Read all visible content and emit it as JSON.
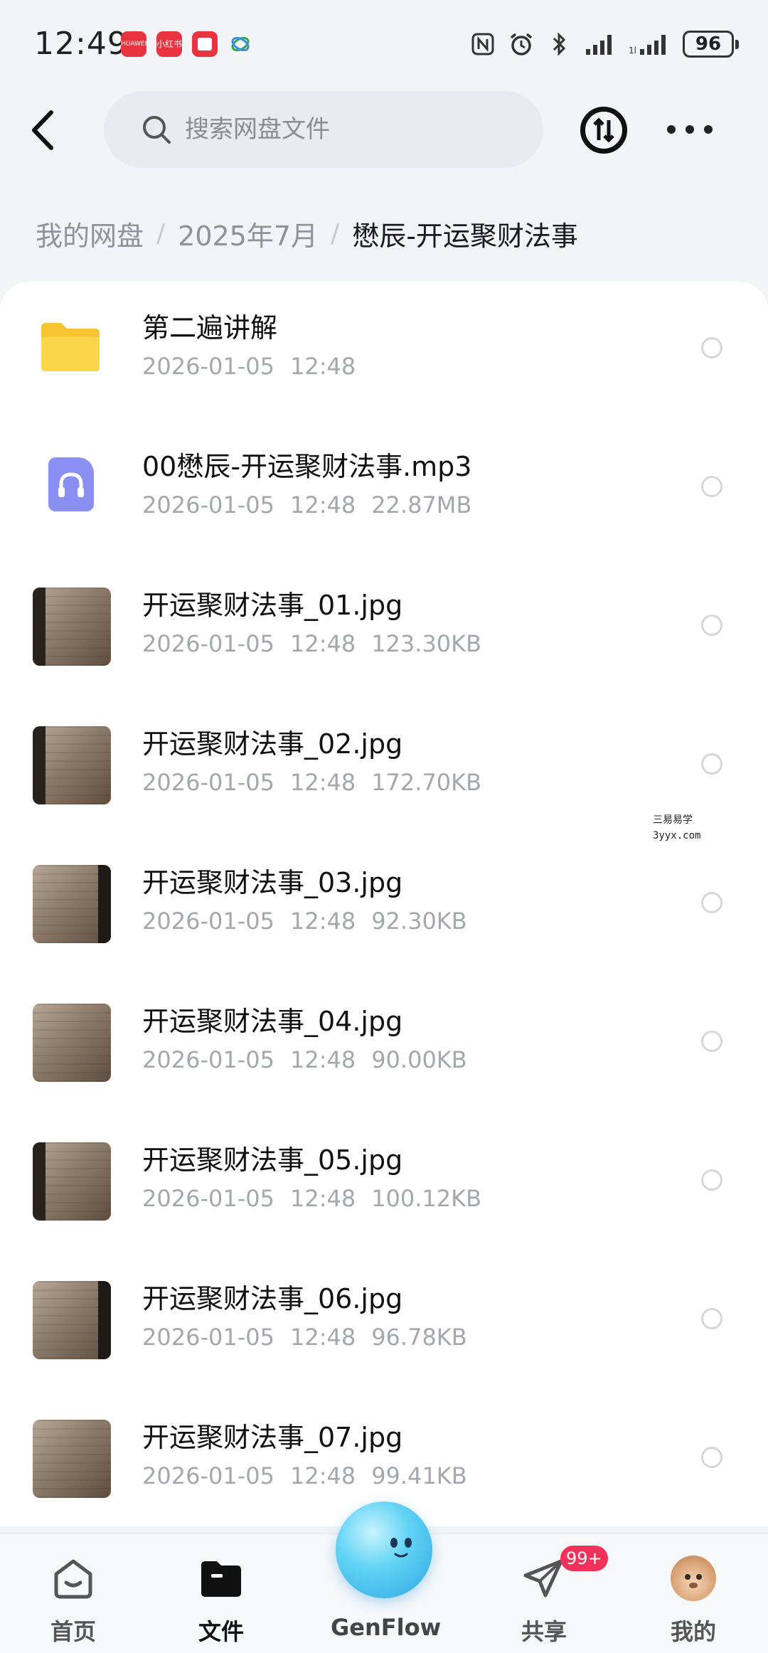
{
  "status_bar": {
    "time": "12:49",
    "apps": [
      "HUAWEI",
      "小红书",
      "",
      ""
    ],
    "battery": "96"
  },
  "header": {
    "search_placeholder": "搜索网盘文件"
  },
  "breadcrumb": {
    "items": [
      "我的网盘",
      "2025年7月"
    ],
    "current": "懋辰-开运聚财法事"
  },
  "files": [
    {
      "name": "第二遍讲解",
      "date": "2026-01-05",
      "time": "12:48",
      "size": "",
      "type": "folder"
    },
    {
      "name": "00懋辰-开运聚财法事.mp3",
      "date": "2026-01-05",
      "time": "12:48",
      "size": "22.87MB",
      "type": "audio"
    },
    {
      "name": "开运聚财法事_01.jpg",
      "date": "2026-01-05",
      "time": "12:48",
      "size": "123.30KB",
      "type": "image"
    },
    {
      "name": "开运聚财法事_02.jpg",
      "date": "2026-01-05",
      "time": "12:48",
      "size": "172.70KB",
      "type": "image"
    },
    {
      "name": "开运聚财法事_03.jpg",
      "date": "2026-01-05",
      "time": "12:48",
      "size": "92.30KB",
      "type": "image"
    },
    {
      "name": "开运聚财法事_04.jpg",
      "date": "2026-01-05",
      "time": "12:48",
      "size": "90.00KB",
      "type": "image"
    },
    {
      "name": "开运聚财法事_05.jpg",
      "date": "2026-01-05",
      "time": "12:48",
      "size": "100.12KB",
      "type": "image"
    },
    {
      "name": "开运聚财法事_06.jpg",
      "date": "2026-01-05",
      "time": "12:48",
      "size": "96.78KB",
      "type": "image"
    },
    {
      "name": "开运聚财法事_07.jpg",
      "date": "2026-01-05",
      "time": "12:48",
      "size": "99.41KB",
      "type": "image"
    }
  ],
  "watermark": {
    "line1": "三易易学",
    "line2": "3yyx.com"
  },
  "bottom_nav": {
    "home": "首页",
    "files": "文件",
    "genflow": "GenFlow",
    "share": "共享",
    "share_badge": "99+",
    "me": "我的"
  },
  "colors": {
    "accent": "#111111",
    "folder": "#f7c531",
    "audio_icon": "#8a8ff2",
    "badge": "#f2315a",
    "genflow": "#3bb6ec"
  }
}
